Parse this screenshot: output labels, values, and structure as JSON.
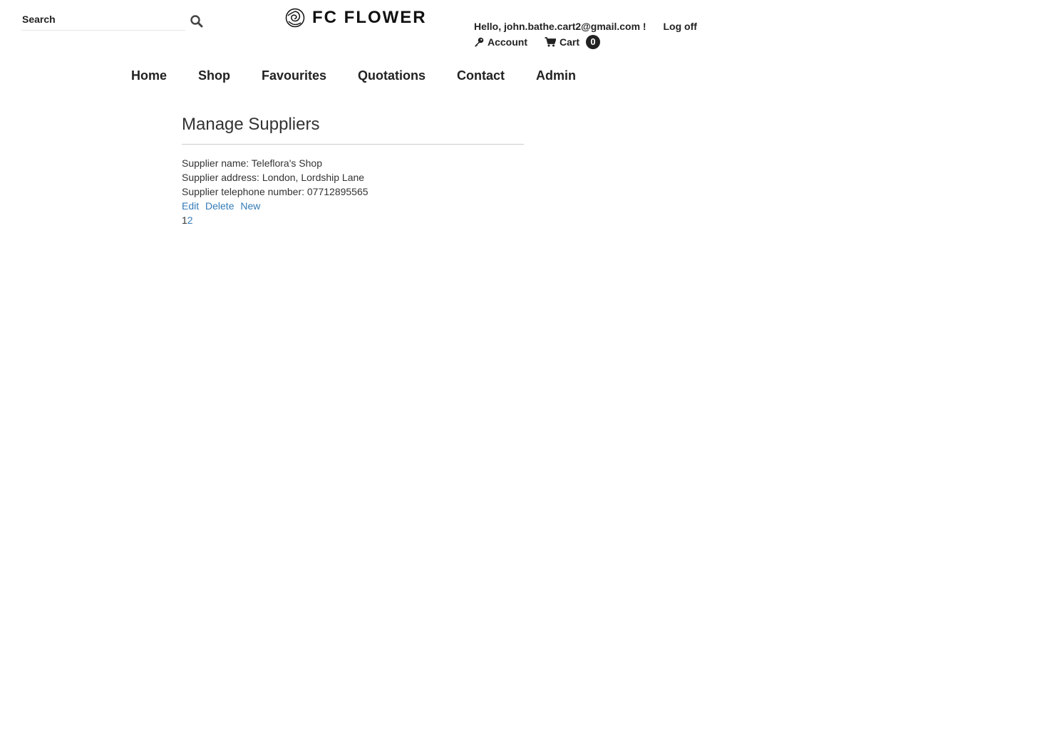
{
  "header": {
    "search": {
      "placeholder": "Search"
    },
    "logo": {
      "text": "FC FLOWER",
      "icon": "rose-icon"
    },
    "user": {
      "greeting": "Hello, john.bathe.cart2@gmail.com !",
      "logoff_label": "Log off",
      "account_label": "Account",
      "cart_label": "Cart",
      "cart_count": "0"
    }
  },
  "nav": {
    "items": [
      {
        "label": "Home"
      },
      {
        "label": "Shop"
      },
      {
        "label": "Favourites"
      },
      {
        "label": "Quotations"
      },
      {
        "label": "Contact"
      },
      {
        "label": "Admin"
      }
    ]
  },
  "main": {
    "title": "Manage Suppliers",
    "supplier": {
      "name_line": "Supplier name: Teleflora's Shop",
      "address_line": "Supplier address: London, Lordship Lane",
      "phone_line": "Supplier telephone number: 07712895565"
    },
    "actions": {
      "edit": "Edit",
      "delete": "Delete",
      "new": "New"
    },
    "pager": {
      "current": "1",
      "next": "2"
    }
  },
  "colors": {
    "link": "#337ab7",
    "text": "#333333",
    "badge_bg": "#222222"
  }
}
